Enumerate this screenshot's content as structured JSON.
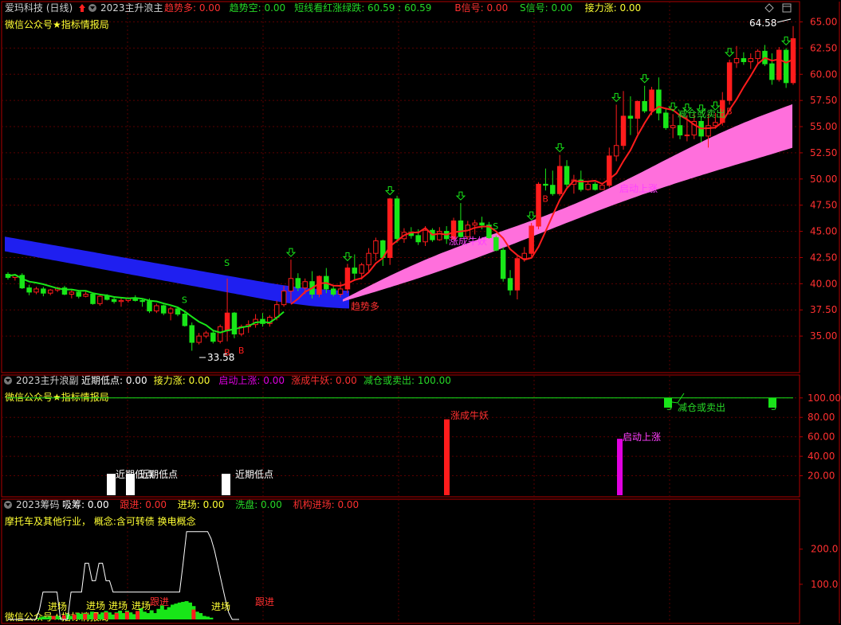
{
  "colors": {
    "background": "#000000",
    "frame": "#b00000",
    "grid": "#5a0000",
    "up": "#ff1c1c",
    "down": "#18e618",
    "blue_band": "#1f1ff0",
    "pink_band": "#ff6fdc",
    "magenta": "#e000e0",
    "yellow": "#ffff33",
    "white": "#ffffff",
    "axis_text": "#ff3030",
    "green_text": "#27d827"
  },
  "header1": {
    "stock": "爱玛科技 (日线)",
    "indicator": "2023主升浪主",
    "items": [
      {
        "label": "趋势多:",
        "value": "0.00",
        "color": "#ff3030"
      },
      {
        "label": "趋势空:",
        "value": "0.00",
        "color": "#27d827"
      },
      {
        "label": "短线看红涨绿跌:",
        "value": "60.59 : 60.59",
        "color": "#27d827"
      },
      {
        "label": "B信号:",
        "value": "0.00",
        "color": "#ff3030"
      },
      {
        "label": "S信号:",
        "value": "0.00",
        "color": "#27d827"
      },
      {
        "label": "接力涨:",
        "value": "0.00",
        "color": "#ffff33"
      }
    ]
  },
  "header1_sub": "微信公众号★指标情报局",
  "header2": {
    "indicator": "2023主升浪副",
    "items": [
      {
        "label": "近期低点:",
        "value": "0.00",
        "color": "#ffffff"
      },
      {
        "label": "接力涨:",
        "value": "0.00",
        "color": "#ffff33"
      },
      {
        "label": "启动上涨:",
        "value": "0.00",
        "color": "#e000e0"
      },
      {
        "label": "涨成牛妖:",
        "value": "0.00",
        "color": "#ff3030"
      },
      {
        "label": "减仓或卖出:",
        "value": "100.00",
        "color": "#27d827"
      }
    ]
  },
  "header2_sub": "微信公众号★指标情报局",
  "header3": {
    "indicator": "2023筹码",
    "items": [
      {
        "label": "吸筹:",
        "value": "0.00",
        "color": "#ffffff"
      },
      {
        "label": "跟进:",
        "value": "0.00",
        "color": "#ff3030"
      },
      {
        "label": "进场:",
        "value": "0.00",
        "color": "#ffff33"
      },
      {
        "label": "洗盘:",
        "value": "0.00",
        "color": "#27d827"
      },
      {
        "label": "机构进场:",
        "value": "0.00",
        "color": "#ff3030"
      }
    ]
  },
  "header3_sub": "摩托车及其他行业， 概念:含可转债 换电概念",
  "header3_bottom": "微信公众号★指标情报局",
  "labels": {
    "high": "64.58",
    "low": "33.58",
    "trend_long": "趋势多",
    "launch": "启动上涨",
    "bull": "涨成牛妖",
    "reduce": "减仓或卖出",
    "recent_low": "近期低点",
    "b": "B",
    "s": "S",
    "enter": "进场",
    "follow": "跟进"
  },
  "chart_data": [
    {
      "type": "candlestick",
      "name": "main",
      "y_ticks": [
        "35.00",
        "37.50",
        "40.00",
        "42.50",
        "45.00",
        "47.50",
        "50.00",
        "52.50",
        "55.00",
        "57.50",
        "60.00",
        "62.50",
        "65.00"
      ],
      "ylim": [
        32.5,
        65.8
      ],
      "candles": [
        [
          40.9,
          41.1,
          40.4,
          40.6
        ],
        [
          40.6,
          40.9,
          40.3,
          40.8
        ],
        [
          40.8,
          41.0,
          39.5,
          39.6
        ],
        [
          39.6,
          39.9,
          38.9,
          39.2
        ],
        [
          39.2,
          39.7,
          39.0,
          39.5
        ],
        [
          39.5,
          39.7,
          38.8,
          39.1
        ],
        [
          39.1,
          39.5,
          38.9,
          39.4
        ],
        [
          39.4,
          39.7,
          39.2,
          39.6
        ],
        [
          39.6,
          39.8,
          38.9,
          39.0
        ],
        [
          39.0,
          39.4,
          38.6,
          39.2
        ],
        [
          39.2,
          39.4,
          38.6,
          38.8
        ],
        [
          38.8,
          39.3,
          38.7,
          39.0
        ],
        [
          39.0,
          39.1,
          38.0,
          38.1
        ],
        [
          38.1,
          38.9,
          37.9,
          38.8
        ],
        [
          38.8,
          39.0,
          38.4,
          38.5
        ],
        [
          38.5,
          38.8,
          38.1,
          38.3
        ],
        [
          38.3,
          38.6,
          37.8,
          38.4
        ],
        [
          38.4,
          38.7,
          38.2,
          38.6
        ],
        [
          38.6,
          38.9,
          38.3,
          38.4
        ],
        [
          38.4,
          38.6,
          37.8,
          38.3
        ],
        [
          38.3,
          38.6,
          37.2,
          37.4
        ],
        [
          37.4,
          38.1,
          37.2,
          37.9
        ],
        [
          37.9,
          38.0,
          37.0,
          37.2
        ],
        [
          37.2,
          37.8,
          36.5,
          37.6
        ],
        [
          37.6,
          37.8,
          36.9,
          37.1
        ],
        [
          37.1,
          37.4,
          35.9,
          36.0
        ],
        [
          36.0,
          36.3,
          33.6,
          34.4
        ],
        [
          34.4,
          35.3,
          34.2,
          35.0
        ],
        [
          35.0,
          35.5,
          34.8,
          35.3
        ],
        [
          35.3,
          35.5,
          34.3,
          34.5
        ],
        [
          34.5,
          36.1,
          34.3,
          35.9
        ],
        [
          35.5,
          40.5,
          34.5,
          37.2
        ],
        [
          37.2,
          37.3,
          34.8,
          35.2
        ],
        [
          35.2,
          36.1,
          35.0,
          35.9
        ],
        [
          35.9,
          36.5,
          35.3,
          36.1
        ],
        [
          36.1,
          37.1,
          35.8,
          36.6
        ],
        [
          36.6,
          37.2,
          35.9,
          36.2
        ],
        [
          36.2,
          37.0,
          35.9,
          36.8
        ],
        [
          36.8,
          38.4,
          36.5,
          38.0
        ],
        [
          38.0,
          39.8,
          37.8,
          39.3
        ],
        [
          39.3,
          42.3,
          38.2,
          40.5
        ],
        [
          40.5,
          41.0,
          39.3,
          39.6
        ],
        [
          39.6,
          40.5,
          39.0,
          40.2
        ],
        [
          40.2,
          41.2,
          38.6,
          39.0
        ],
        [
          39.0,
          40.8,
          38.7,
          40.7
        ],
        [
          40.7,
          41.5,
          39.1,
          39.5
        ],
        [
          39.5,
          39.8,
          38.8,
          39.0
        ],
        [
          39.0,
          40.2,
          38.7,
          39.5
        ],
        [
          39.5,
          41.9,
          39.1,
          41.5
        ],
        [
          41.5,
          42.8,
          40.3,
          41.0
        ],
        [
          41.0,
          42.0,
          40.4,
          41.8
        ],
        [
          41.8,
          43.4,
          41.0,
          42.9
        ],
        [
          42.9,
          44.4,
          42.2,
          44.1
        ],
        [
          44.1,
          44.2,
          41.7,
          42.5
        ],
        [
          42.5,
          48.2,
          41.8,
          48.1
        ],
        [
          48.1,
          48.4,
          43.9,
          44.3
        ],
        [
          44.3,
          45.3,
          43.9,
          44.9
        ],
        [
          44.9,
          45.4,
          44.3,
          44.6
        ],
        [
          44.6,
          45.2,
          43.7,
          44.0
        ],
        [
          44.0,
          45.5,
          43.6,
          45.1
        ],
        [
          45.1,
          45.3,
          44.0,
          44.2
        ],
        [
          44.2,
          45.4,
          44.1,
          45.0
        ],
        [
          45.0,
          45.5,
          43.8,
          44.3
        ],
        [
          44.3,
          46.3,
          44.1,
          46.0
        ],
        [
          46.0,
          47.7,
          44.4,
          44.5
        ],
        [
          44.5,
          46.0,
          44.2,
          45.6
        ],
        [
          45.6,
          46.1,
          44.7,
          45.8
        ],
        [
          45.8,
          46.4,
          45.2,
          45.6
        ],
        [
          45.6,
          45.9,
          44.3,
          44.4
        ],
        [
          44.4,
          44.6,
          43.1,
          43.2
        ],
        [
          43.2,
          43.5,
          40.2,
          40.5
        ],
        [
          40.5,
          41.3,
          38.9,
          39.4
        ],
        [
          39.4,
          42.8,
          38.5,
          42.4
        ],
        [
          42.4,
          43.5,
          42.1,
          42.9
        ],
        [
          42.9,
          45.8,
          42.6,
          45.5
        ],
        [
          45.5,
          49.7,
          45.2,
          49.5
        ],
        [
          49.5,
          51.0,
          48.9,
          49.4
        ],
        [
          49.4,
          50.8,
          48.4,
          48.6
        ],
        [
          48.6,
          52.3,
          48.4,
          51.2
        ],
        [
          51.2,
          51.8,
          49.2,
          49.5
        ],
        [
          49.5,
          50.4,
          48.6,
          49.9
        ],
        [
          49.9,
          50.8,
          48.8,
          49.0
        ],
        [
          49.0,
          49.7,
          48.9,
          49.5
        ],
        [
          49.5,
          49.7,
          48.9,
          49.0
        ],
        [
          49.0,
          49.4,
          49.0,
          49.4
        ],
        [
          49.4,
          53.0,
          49.2,
          52.2
        ],
        [
          52.2,
          57.1,
          51.7,
          53.2
        ],
        [
          53.2,
          58.4,
          52.8,
          56.0
        ],
        [
          56.0,
          57.9,
          54.2,
          55.8
        ],
        [
          55.8,
          57.5,
          54.3,
          57.4
        ],
        [
          57.4,
          58.9,
          56.3,
          56.5
        ],
        [
          56.5,
          58.8,
          56.1,
          58.5
        ],
        [
          58.5,
          59.7,
          55.6,
          56.3
        ],
        [
          56.3,
          56.8,
          54.7,
          54.9
        ],
        [
          54.9,
          56.2,
          53.9,
          55.1
        ],
        [
          55.1,
          56.4,
          53.8,
          54.2
        ],
        [
          54.2,
          56.1,
          53.6,
          54.2
        ],
        [
          54.2,
          56.3,
          53.8,
          55.5
        ],
        [
          55.5,
          56.0,
          53.5,
          54.1
        ],
        [
          54.1,
          56.2,
          53.0,
          55.1
        ],
        [
          55.1,
          56.3,
          54.8,
          55.4
        ],
        [
          55.4,
          58.3,
          55.1,
          57.5
        ],
        [
          57.5,
          61.4,
          57.1,
          61.1
        ],
        [
          61.1,
          62.7,
          60.6,
          61.5
        ],
        [
          61.5,
          62.1,
          60.9,
          61.2
        ],
        [
          61.2,
          62.0,
          60.5,
          61.5
        ],
        [
          61.5,
          62.4,
          60.9,
          62.2
        ],
        [
          62.2,
          62.8,
          60.8,
          61.0
        ],
        [
          61.0,
          62.0,
          59.0,
          59.5
        ],
        [
          59.5,
          62.6,
          59.3,
          62.3
        ],
        [
          62.3,
          62.5,
          58.7,
          59.2
        ],
        [
          59.2,
          64.6,
          59.0,
          63.4
        ]
      ]
    },
    {
      "type": "bar",
      "name": "sub",
      "y_ticks": [
        "20.00",
        "40.00",
        "60.00",
        "80.00",
        "100.00"
      ],
      "ylim": [
        0,
        108
      ],
      "recent_low_bars": [
        {
          "index": 28,
          "value": 22
        },
        {
          "index": 30,
          "value": 22
        },
        {
          "index": 57,
          "value": 22
        }
      ],
      "bull_bar": {
        "index": 113,
        "value": 78
      },
      "launch_bar": {
        "index": 157,
        "value": 58
      },
      "reduce_line": 100,
      "reduce_bars": [
        {
          "index": 168,
          "value": 90
        },
        {
          "index": 195,
          "value": 90
        }
      ]
    },
    {
      "type": "line+bar",
      "name": "chip",
      "y_ticks": [
        "100.0",
        "200.0"
      ],
      "ylim": [
        0,
        290
      ],
      "white_line": [
        0,
        0,
        0,
        0,
        0,
        0,
        0,
        0,
        0,
        28,
        78,
        78,
        78,
        78,
        78,
        0,
        0,
        0,
        78,
        78,
        78,
        78,
        160,
        160,
        110,
        110,
        160,
        160,
        110,
        110,
        78,
        78,
        78,
        78,
        78,
        78,
        78,
        78,
        78,
        78,
        78,
        78,
        78,
        78,
        78,
        78,
        78,
        78,
        78,
        78,
        160,
        250,
        250,
        250,
        250,
        250,
        250,
        250,
        230,
        195,
        150,
        105,
        60,
        20,
        0,
        0,
        0
      ],
      "bars_green": [
        0,
        0,
        0,
        0,
        0,
        0,
        0,
        0,
        0,
        5,
        8,
        6,
        8,
        6,
        10,
        6,
        8,
        15,
        10,
        12,
        18,
        16,
        18,
        14,
        22,
        18,
        15,
        20,
        24,
        20,
        14,
        20,
        25,
        18,
        25,
        20,
        15,
        22,
        32,
        22,
        18,
        26,
        18,
        30,
        40,
        28,
        35,
        42,
        45,
        48,
        50,
        52,
        48,
        38,
        22,
        18,
        10,
        8,
        5,
        0,
        0,
        0,
        0,
        0,
        0,
        0,
        0
      ],
      "bars_red": [
        0,
        0,
        0,
        0,
        0,
        0,
        0,
        0,
        0,
        0,
        0,
        0,
        0,
        10,
        0,
        0,
        12,
        0,
        0,
        14,
        0,
        0,
        16,
        0,
        0,
        18,
        0,
        0,
        20,
        0,
        0,
        18,
        0,
        0,
        22,
        0,
        0,
        24,
        0,
        0,
        0,
        0,
        0,
        0,
        0,
        0,
        0,
        0,
        0,
        0,
        0,
        0,
        0,
        28,
        0,
        0,
        0,
        0,
        0,
        0,
        0,
        0,
        0,
        0,
        0,
        0,
        0
      ]
    }
  ]
}
